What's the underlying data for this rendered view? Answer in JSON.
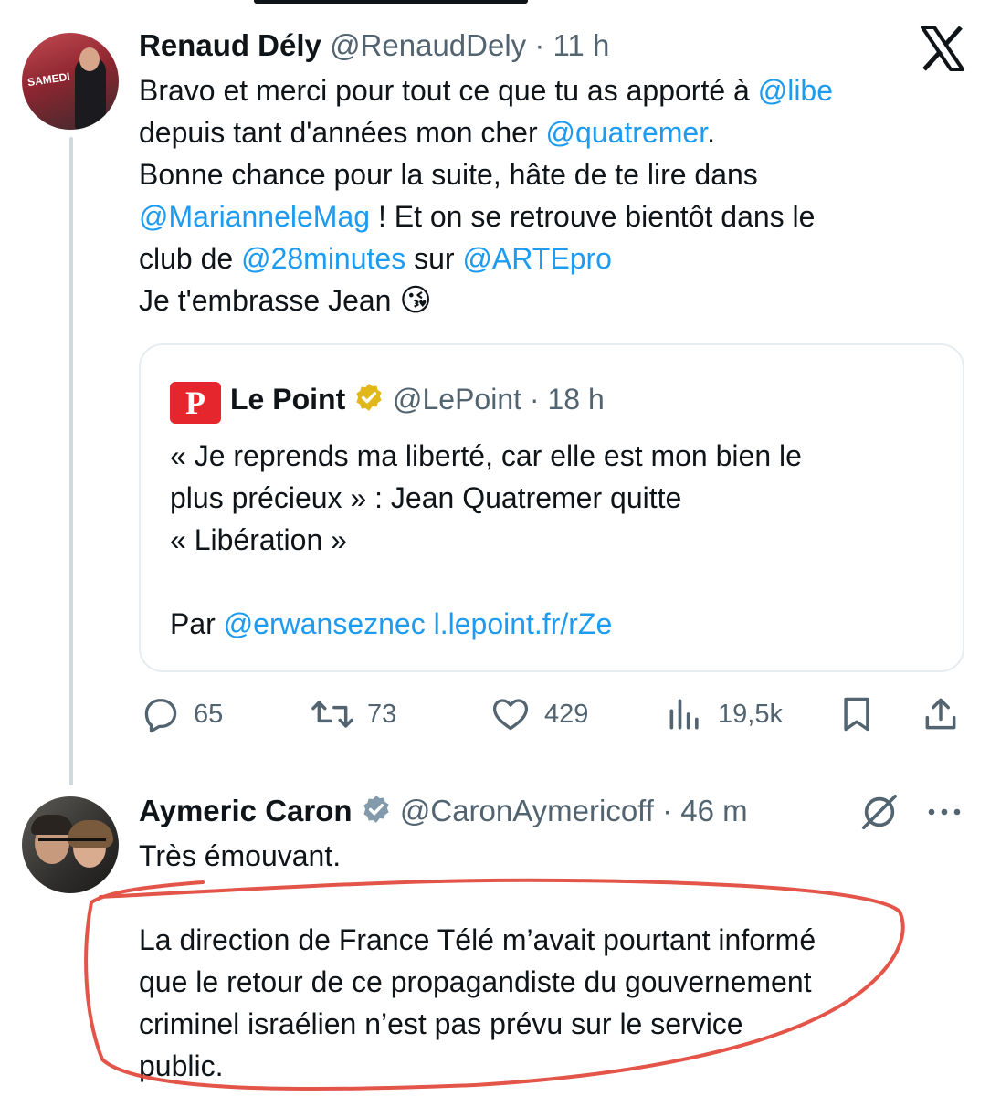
{
  "tweet1": {
    "author_name": "Renaud Dély",
    "handle": "@RenaudDely",
    "time": "· 11 h",
    "avatar_label": "SAMEDI",
    "lines": [
      {
        "parts": [
          {
            "t": "Bravo et merci pour tout ce que tu as apporté à "
          },
          {
            "t": "@libe",
            "link": true
          }
        ]
      },
      {
        "parts": [
          {
            "t": "depuis tant d'années mon cher "
          },
          {
            "t": "@quatremer",
            "link": true
          },
          {
            "t": "."
          }
        ]
      },
      {
        "parts": [
          {
            "t": "Bonne chance pour la suite, hâte de te lire dans"
          }
        ]
      },
      {
        "parts": [
          {
            "t": "@MarianneleMag",
            "link": true
          },
          {
            "t": " ! Et on se retrouve bientôt dans le"
          }
        ]
      },
      {
        "parts": [
          {
            "t": "club de "
          },
          {
            "t": "@28minutes",
            "link": true
          },
          {
            "t": " sur "
          },
          {
            "t": "@ARTEpro",
            "link": true
          }
        ]
      },
      {
        "parts": [
          {
            "t": "Je t'embrasse Jean "
          },
          {
            "t": "😘",
            "emoji": true
          }
        ]
      }
    ],
    "quote": {
      "logo_letter": "P",
      "author_name": "Le Point",
      "handle": "@LePoint",
      "time": "· 18 h",
      "lines": [
        {
          "parts": [
            {
              "t": "« Je reprends ma liberté, car elle est mon bien le"
            }
          ]
        },
        {
          "parts": [
            {
              "t": "plus précieux » : Jean Quatremer quitte"
            }
          ]
        },
        {
          "parts": [
            {
              "t": "« Libération »"
            }
          ]
        },
        {
          "parts": [
            {
              "t": ""
            }
          ]
        },
        {
          "parts": [
            {
              "t": "Par "
            },
            {
              "t": "@erwanseznec",
              "link": true
            },
            {
              "t": " "
            },
            {
              "t": "l.lepoint.fr/rZe",
              "link": true
            }
          ]
        }
      ]
    },
    "actions": {
      "replies": "65",
      "retweets": "73",
      "likes": "429",
      "views": "19,5k"
    }
  },
  "tweet2": {
    "author_name": "Aymeric Caron",
    "handle": "@CaronAymericoff",
    "time": "· 46 m",
    "lines": [
      {
        "parts": [
          {
            "t": "Très émouvant."
          }
        ]
      },
      {
        "parts": [
          {
            "t": ""
          }
        ]
      },
      {
        "parts": [
          {
            "t": "La direction de France Télé m’avait pourtant informé"
          }
        ]
      },
      {
        "parts": [
          {
            "t": "que le retour de ce propagandiste du gouvernement"
          }
        ]
      },
      {
        "parts": [
          {
            "t": "criminel israélien n’est pas prévu sur le service"
          }
        ]
      },
      {
        "parts": [
          {
            "t": "public."
          }
        ]
      }
    ]
  },
  "colors": {
    "link": "#1d9bf0",
    "muted": "#536471",
    "annotation": "#e2473a",
    "verified": "#829aab",
    "gold_verified": "#e2b719",
    "le_point_red": "#e5262c"
  }
}
